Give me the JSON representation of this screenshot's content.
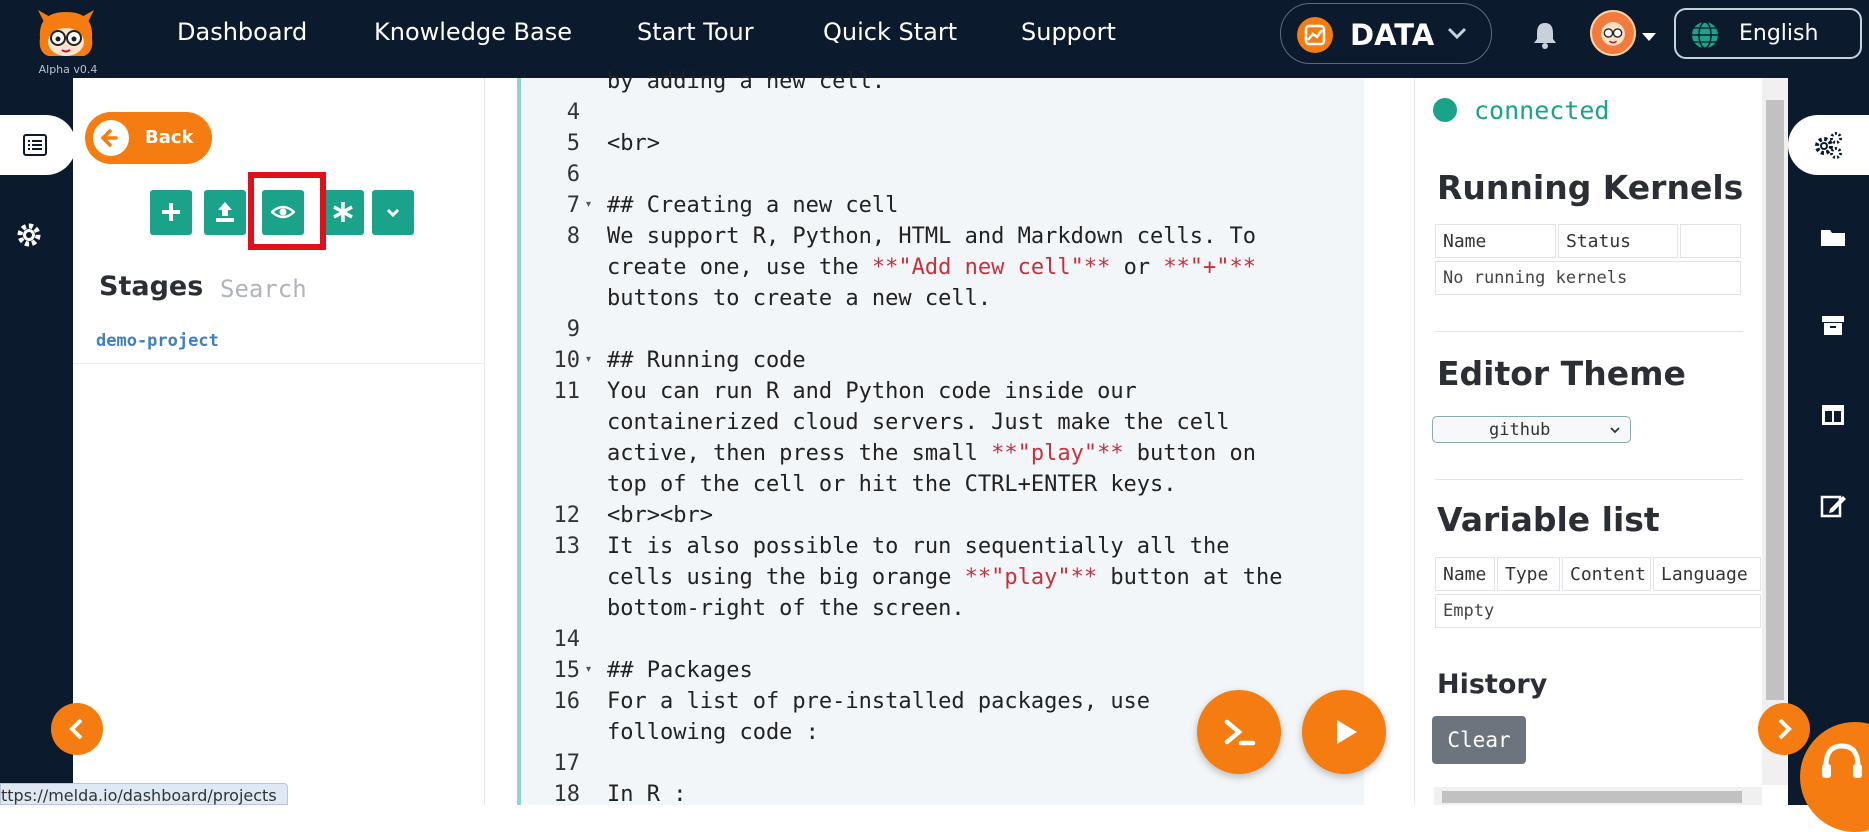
{
  "app": {
    "version": "Alpha v0.4"
  },
  "nav": {
    "items": [
      {
        "label": "Dashboard"
      },
      {
        "label": "Knowledge Base"
      },
      {
        "label": "Start Tour"
      },
      {
        "label": "Quick Start"
      },
      {
        "label": "Support"
      }
    ],
    "data_selector": "DATA",
    "language": "English"
  },
  "sidebar": {
    "back_label": "Back",
    "stages_title": "Stages",
    "search_placeholder": "Search",
    "projects": [
      "demo-project"
    ]
  },
  "editor": {
    "lines": [
      {
        "num": "",
        "fold": false,
        "parts": [
          {
            "t": "by adding a new cell."
          }
        ]
      },
      {
        "num": "4",
        "fold": false,
        "parts": [
          {
            "t": ""
          }
        ]
      },
      {
        "num": "5",
        "fold": false,
        "parts": [
          {
            "t": "<br>"
          }
        ]
      },
      {
        "num": "6",
        "fold": false,
        "parts": [
          {
            "t": ""
          }
        ]
      },
      {
        "num": "7",
        "fold": true,
        "parts": [
          {
            "t": "## Creating a new cell"
          }
        ]
      },
      {
        "num": "8",
        "fold": false,
        "parts": [
          {
            "t": "We support R, Python, HTML and Markdown cells. To"
          }
        ]
      },
      {
        "num": "",
        "fold": false,
        "parts": [
          {
            "t": "create one, use the "
          },
          {
            "t": "**\"Add new cell\"**",
            "red": true
          },
          {
            "t": " or "
          },
          {
            "t": "**\"+\"**",
            "red": true
          }
        ]
      },
      {
        "num": "",
        "fold": false,
        "parts": [
          {
            "t": "buttons to create a new cell."
          }
        ]
      },
      {
        "num": "9",
        "fold": false,
        "parts": [
          {
            "t": ""
          }
        ]
      },
      {
        "num": "10",
        "fold": true,
        "parts": [
          {
            "t": "## Running code"
          }
        ]
      },
      {
        "num": "11",
        "fold": false,
        "parts": [
          {
            "t": "You can run R and Python code inside our"
          }
        ]
      },
      {
        "num": "",
        "fold": false,
        "parts": [
          {
            "t": "containerized cloud servers. Just make the cell"
          }
        ]
      },
      {
        "num": "",
        "fold": false,
        "parts": [
          {
            "t": "active, then press the small "
          },
          {
            "t": "**\"play\"**",
            "red": true
          },
          {
            "t": " button on"
          }
        ]
      },
      {
        "num": "",
        "fold": false,
        "parts": [
          {
            "t": "top of the cell or hit the CTRL+ENTER keys."
          }
        ]
      },
      {
        "num": "12",
        "fold": false,
        "parts": [
          {
            "t": "<br><br>"
          }
        ]
      },
      {
        "num": "13",
        "fold": false,
        "parts": [
          {
            "t": "It is also possible to run sequentially all the"
          }
        ]
      },
      {
        "num": "",
        "fold": false,
        "parts": [
          {
            "t": "cells using the big orange "
          },
          {
            "t": "**\"play\"**",
            "red": true
          },
          {
            "t": " button at the"
          }
        ]
      },
      {
        "num": "",
        "fold": false,
        "parts": [
          {
            "t": "bottom-right of the screen."
          }
        ]
      },
      {
        "num": "14",
        "fold": false,
        "parts": [
          {
            "t": ""
          }
        ]
      },
      {
        "num": "15",
        "fold": true,
        "parts": [
          {
            "t": "## Packages"
          }
        ]
      },
      {
        "num": "16",
        "fold": false,
        "parts": [
          {
            "t": "For a list of pre-installed packages, use"
          }
        ]
      },
      {
        "num": "",
        "fold": false,
        "parts": [
          {
            "t": "following code :"
          }
        ]
      },
      {
        "num": "17",
        "fold": false,
        "parts": [
          {
            "t": ""
          }
        ]
      },
      {
        "num": "18",
        "fold": false,
        "parts": [
          {
            "t": "In R :"
          }
        ]
      }
    ]
  },
  "panel": {
    "connection_status": "connected",
    "running_kernels": {
      "title": "Running Kernels",
      "columns": [
        "Name",
        "Status",
        ""
      ],
      "empty_text": "No running kernels"
    },
    "editor_theme": {
      "title": "Editor Theme",
      "selected": "github"
    },
    "variable_list": {
      "title": "Variable list",
      "columns": [
        "Name",
        "Type",
        "Content",
        "Language"
      ],
      "empty_text": "Empty"
    },
    "history": {
      "title": "History",
      "clear_label": "Clear"
    }
  },
  "status_bar": {
    "url": "ttps://melda.io/dashboard/projects"
  },
  "colors": {
    "nav_bg": "#0c1a2e",
    "accent_orange": "#f57c10",
    "teal": "#1aa38a",
    "highlight_red": "#e0101a"
  }
}
